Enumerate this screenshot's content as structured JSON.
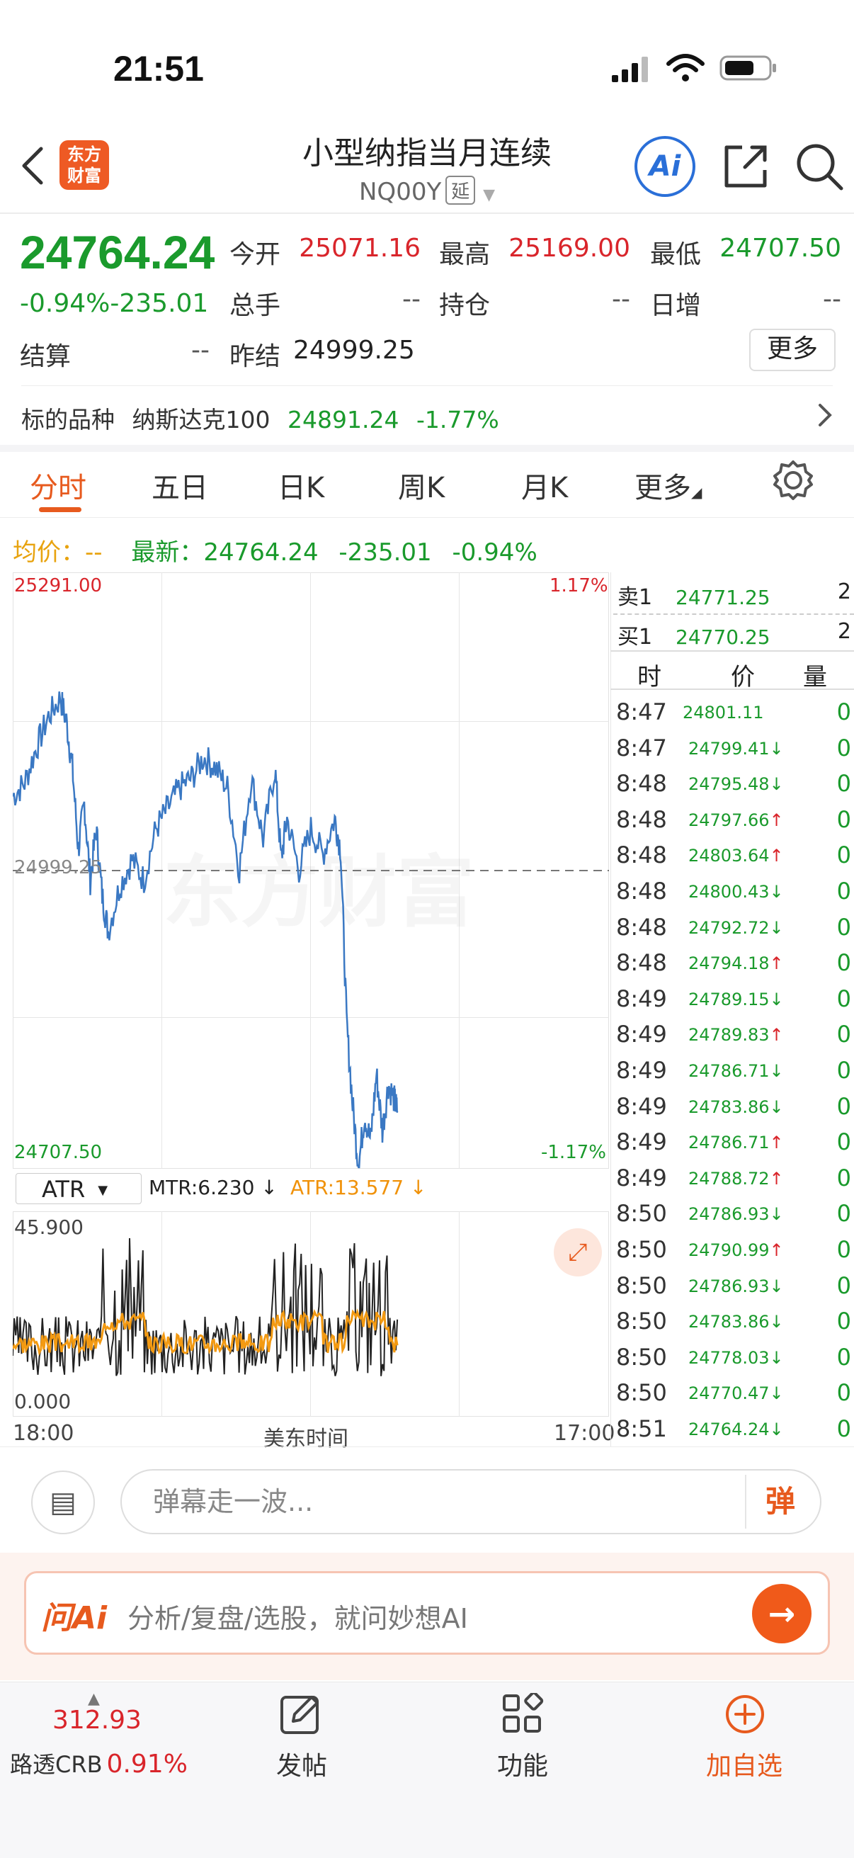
{
  "status_bar": {
    "time": "21:51"
  },
  "header": {
    "title": "小型纳指当月连续",
    "code": "NQ00Y",
    "delay_tag": "延",
    "logo_text": "东方财富",
    "ai_label": "Ai"
  },
  "quote": {
    "price": "24764.24",
    "change_pct": "-0.94%",
    "change_abs": "-235.01",
    "fields": {
      "open_label": "今开",
      "open": "25071.16",
      "high_label": "最高",
      "high": "25169.00",
      "low_label": "最低",
      "low": "24707.50",
      "volume_label": "总手",
      "volume": "--",
      "position_label": "持仓",
      "position": "--",
      "daily_inc_label": "日增",
      "daily_inc": "--",
      "settle_label": "结算",
      "settle": "--",
      "prev_settle_label": "昨结",
      "prev_settle": "24999.25"
    },
    "more_label": "更多",
    "underlying": {
      "label": "标的品种",
      "name": "纳斯达克100",
      "price": "24891.24",
      "change": "-1.77%"
    }
  },
  "tabs": [
    {
      "label": "分时",
      "active": true
    },
    {
      "label": "五日"
    },
    {
      "label": "日K"
    },
    {
      "label": "周K"
    },
    {
      "label": "月K"
    },
    {
      "label": "更多"
    }
  ],
  "avg_line": {
    "avg_label": "均价：",
    "avg_value": "--",
    "latest_label": "最新：",
    "latest_value": "24764.24",
    "latest_change": "-235.01",
    "latest_pct": "-0.94%"
  },
  "chart": {
    "y_top": "25291.00",
    "y_bottom": "24707.50",
    "pct_top": "1.17%",
    "pct_bottom": "-1.17%",
    "watermark": "东方财富",
    "mid_value": "24999.25",
    "x_start": "18:00",
    "x_mid": "美东时间",
    "x_end": "17:00"
  },
  "chart_data": {
    "type": "line",
    "title": "",
    "xlabel": "美东时间",
    "ylabel": "",
    "ylim": [
      24707.5,
      25291.0
    ],
    "reference_line": 24999.25,
    "series": [
      {
        "name": "",
        "x_fraction": [
          0.0,
          0.02,
          0.04,
          0.06,
          0.08,
          0.09,
          0.1,
          0.11,
          0.12,
          0.13,
          0.14,
          0.15,
          0.16,
          0.18,
          0.2,
          0.22,
          0.24,
          0.26,
          0.28,
          0.3,
          0.32,
          0.34,
          0.36,
          0.38,
          0.4,
          0.42,
          0.44,
          0.45,
          0.46,
          0.48,
          0.5,
          0.52,
          0.54,
          0.55,
          0.56,
          0.57,
          0.58,
          0.59,
          0.6,
          0.61,
          0.62,
          0.63,
          0.64,
          0.645
        ],
        "values": [
          25072,
          25085,
          25120,
          25150,
          25168,
          25145,
          25100,
          25020,
          25065,
          24990,
          25040,
          24975,
          24940,
          24985,
          25010,
          24990,
          25040,
          25060,
          25080,
          25090,
          25110,
          25100,
          25080,
          25000,
          25090,
          25030,
          25100,
          25010,
          25050,
          25000,
          25040,
          25015,
          25050,
          25020,
          24850,
          24770,
          24710,
          24760,
          24735,
          24800,
          24745,
          24790,
          24775,
          24764
        ]
      }
    ]
  },
  "indicator": {
    "name": "ATR",
    "mtr_text": "MTR:6.230 ↓",
    "atr_text": "ATR:13.577 ↓",
    "y_max": "45.900",
    "y_min": "0.000"
  },
  "order_book": {
    "sell_label": "卖1",
    "sell_price": "24771.25",
    "sell_qty": "2",
    "buy_label": "买1",
    "buy_price": "24770.25",
    "buy_qty": "2",
    "headers": [
      "时",
      "价",
      "量"
    ],
    "ticks": [
      {
        "time": "8:47",
        "price": "24801.11",
        "dir": "",
        "qty": "0"
      },
      {
        "time": "8:47",
        "price": "24799.41",
        "dir": "↓",
        "qty": "0"
      },
      {
        "time": "8:48",
        "price": "24795.48",
        "dir": "↓",
        "qty": "0"
      },
      {
        "time": "8:48",
        "price": "24797.66",
        "dir": "↑",
        "qty": "0"
      },
      {
        "time": "8:48",
        "price": "24803.64",
        "dir": "↑",
        "qty": "0"
      },
      {
        "time": "8:48",
        "price": "24800.43",
        "dir": "↓",
        "qty": "0"
      },
      {
        "time": "8:48",
        "price": "24792.72",
        "dir": "↓",
        "qty": "0"
      },
      {
        "time": "8:48",
        "price": "24794.18",
        "dir": "↑",
        "qty": "0"
      },
      {
        "time": "8:49",
        "price": "24789.15",
        "dir": "↓",
        "qty": "0"
      },
      {
        "time": "8:49",
        "price": "24789.83",
        "dir": "↑",
        "qty": "0"
      },
      {
        "time": "8:49",
        "price": "24786.71",
        "dir": "↓",
        "qty": "0"
      },
      {
        "time": "8:49",
        "price": "24783.86",
        "dir": "↓",
        "qty": "0"
      },
      {
        "time": "8:49",
        "price": "24786.71",
        "dir": "↑",
        "qty": "0"
      },
      {
        "time": "8:49",
        "price": "24788.72",
        "dir": "↑",
        "qty": "0"
      },
      {
        "time": "8:50",
        "price": "24786.93",
        "dir": "↓",
        "qty": "0"
      },
      {
        "time": "8:50",
        "price": "24790.99",
        "dir": "↑",
        "qty": "0"
      },
      {
        "time": "8:50",
        "price": "24786.93",
        "dir": "↓",
        "qty": "0"
      },
      {
        "time": "8:50",
        "price": "24783.86",
        "dir": "↓",
        "qty": "0"
      },
      {
        "time": "8:50",
        "price": "24778.03",
        "dir": "↓",
        "qty": "0"
      },
      {
        "time": "8:50",
        "price": "24770.47",
        "dir": "↓",
        "qty": "0"
      },
      {
        "time": "8:51",
        "price": "24764.24",
        "dir": "↓",
        "qty": "0"
      }
    ]
  },
  "danmu": {
    "placeholder": "弹幕走一波...",
    "button": "弹"
  },
  "ask_ai": {
    "logo": "问Ai",
    "placeholder": "分析/复盘/选股，就问妙想AI"
  },
  "bottom_nav": {
    "index_value": "312.93",
    "index_name": "路透CRB",
    "index_pct": "0.91%",
    "items": [
      "发帖",
      "功能",
      "加自选"
    ]
  },
  "colors": {
    "up": "#d9252b",
    "down": "#1a9a2c",
    "accent": "#e75a1e",
    "line": "#3a78c3"
  }
}
